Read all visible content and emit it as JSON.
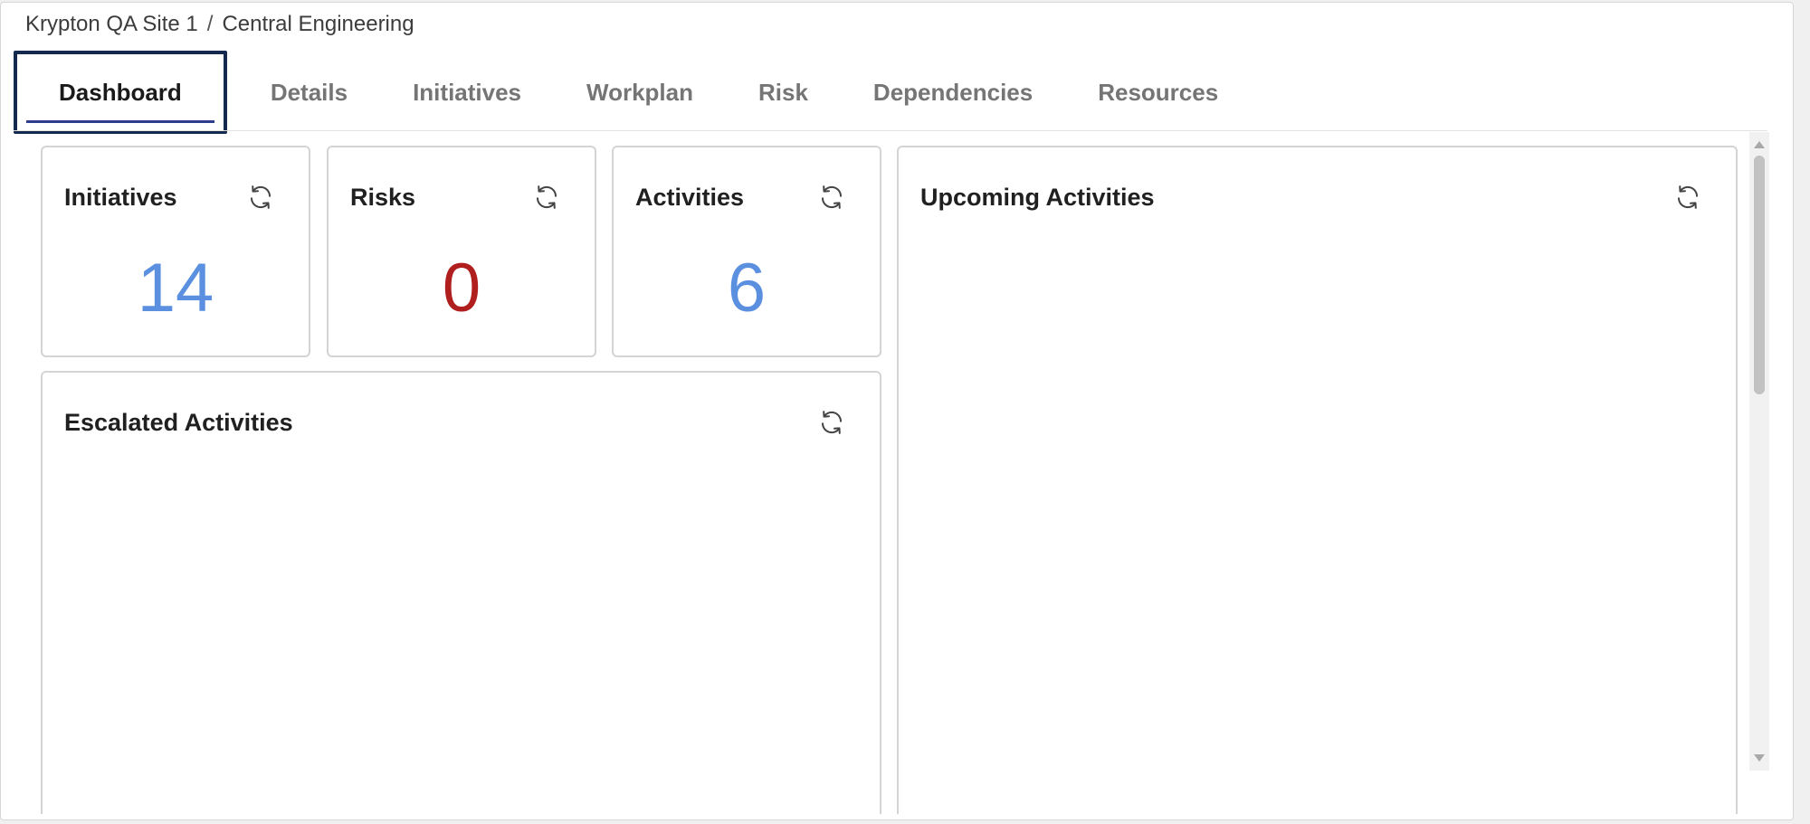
{
  "breadcrumb": {
    "site": "Krypton QA Site 1",
    "separator": "/",
    "section": "Central Engineering"
  },
  "tabs": [
    {
      "label": "Dashboard",
      "active": true
    },
    {
      "label": "Details",
      "active": false
    },
    {
      "label": "Initiatives",
      "active": false
    },
    {
      "label": "Workplan",
      "active": false
    },
    {
      "label": "Risk",
      "active": false
    },
    {
      "label": "Dependencies",
      "active": false
    },
    {
      "label": "Resources",
      "active": false
    }
  ],
  "widgets": {
    "initiatives": {
      "title": "Initiatives",
      "value": "14",
      "color": "#5b8fe0"
    },
    "risks": {
      "title": "Risks",
      "value": "0",
      "color": "#b01e1e"
    },
    "activities": {
      "title": "Activities",
      "value": "6",
      "color": "#5b8fe0"
    },
    "upcoming": {
      "title": "Upcoming Activities"
    },
    "escalated": {
      "title": "Escalated Activities"
    }
  },
  "icons": {
    "refresh": "refresh-icon"
  }
}
